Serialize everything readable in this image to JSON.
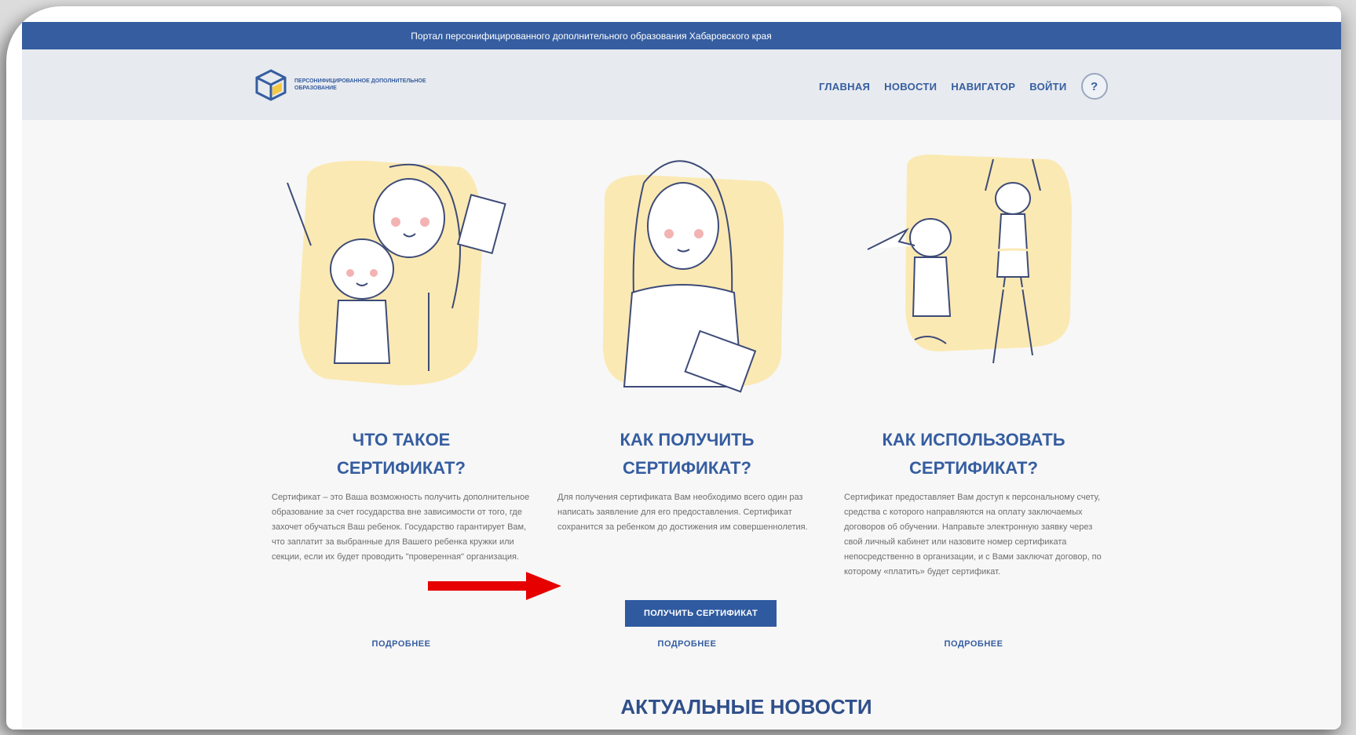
{
  "topbar": {
    "text": "Портал персонифицированного дополнительного образования Хабаровского края"
  },
  "logo": {
    "text": "ПЕРСОНИФИЦИРОВАННОЕ ДОПОЛНИТЕЛЬНОЕ ОБРАЗОВАНИЕ"
  },
  "nav": {
    "items": [
      {
        "label": "ГЛАВНАЯ"
      },
      {
        "label": "НОВОСТИ"
      },
      {
        "label": "НАВИГАТОР"
      },
      {
        "label": "ВОЙТИ"
      }
    ],
    "help_label": "?"
  },
  "columns": [
    {
      "title": "ЧТО ТАКОЕ\nСЕРТИФИКАТ?",
      "text": "Сертификат – это Ваша возможность получить дополнительное образование за счет государства вне зависимости от того, где захочет обучаться Ваш ребенок. Государство гарантирует Вам, что заплатит за выбранные для Вашего ребенка кружки или секции, если их будет проводить \"проверенная\" организация.",
      "more": "ПОДРОБНЕЕ"
    },
    {
      "title": "КАК ПОЛУЧИТЬ\nСЕРТИФИКАТ?",
      "text": "Для получения сертификата Вам необходимо всего один раз написать заявление для его предоставления. Сертификат сохранится за ребенком до достижения им совершеннолетия.",
      "button": "ПОЛУЧИТЬ СЕРТИФИКАТ",
      "more": "ПОДРОБНЕЕ"
    },
    {
      "title": "КАК ИСПОЛЬЗОВАТЬ\nСЕРТИФИКАТ?",
      "text": "Сертификат предоставляет Вам доступ к персональному счету, средства с которого направляются на оплату заключаемых договоров об обучении. Направьте электронную заявку через свой личный кабинет или назовите номер сертификата непосредственно в организации, и с Вами заключат договор, по которому «платить» будет сертификат.",
      "more": "ПОДРОБНЕЕ"
    }
  ],
  "news": {
    "title": "АКТУАЛЬНЫЕ НОВОСТИ"
  },
  "colors": {
    "brand": "#355da0",
    "highlight": "#fbe9b3",
    "arrow": "#e60000"
  }
}
